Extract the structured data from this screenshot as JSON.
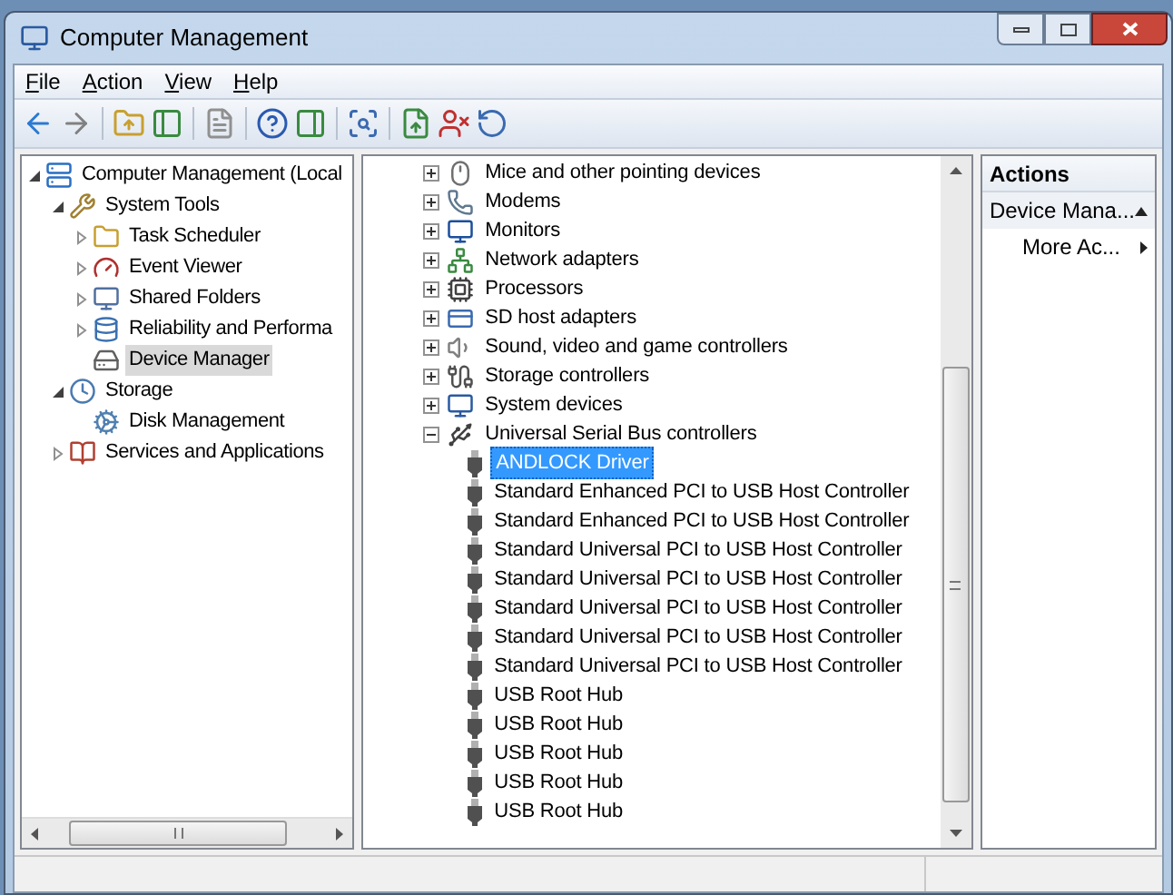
{
  "window": {
    "title": "Computer Management"
  },
  "menu": [
    "File",
    "Action",
    "View",
    "Help"
  ],
  "console_tree": [
    {
      "label": "Computer Management (Local",
      "expanded": true,
      "selected": false,
      "children": [
        {
          "label": "System Tools",
          "expanded": true,
          "selected": false,
          "children": [
            {
              "label": "Task Scheduler",
              "expanded": false,
              "selected": false
            },
            {
              "label": "Event Viewer",
              "expanded": false,
              "selected": false
            },
            {
              "label": "Shared Folders",
              "expanded": false,
              "selected": false
            },
            {
              "label": "Reliability and Performa",
              "expanded": false,
              "selected": false
            },
            {
              "label": "Device Manager",
              "selected": true
            }
          ]
        },
        {
          "label": "Storage",
          "expanded": true,
          "selected": false,
          "children": [
            {
              "label": "Disk Management",
              "selected": false
            }
          ]
        },
        {
          "label": "Services and Applications",
          "expanded": false,
          "selected": false
        }
      ]
    }
  ],
  "device_tree": [
    {
      "label": "Mice and other pointing devices",
      "expanded": false,
      "selected": false
    },
    {
      "label": "Modems",
      "expanded": false,
      "selected": false
    },
    {
      "label": "Monitors",
      "expanded": false,
      "selected": false
    },
    {
      "label": "Network adapters",
      "expanded": false,
      "selected": false
    },
    {
      "label": "Processors",
      "expanded": false,
      "selected": false
    },
    {
      "label": "SD host adapters",
      "expanded": false,
      "selected": false
    },
    {
      "label": "Sound, video and game controllers",
      "expanded": false,
      "selected": false
    },
    {
      "label": "Storage controllers",
      "expanded": false,
      "selected": false
    },
    {
      "label": "System devices",
      "expanded": false,
      "selected": false
    },
    {
      "label": "Universal Serial Bus controllers",
      "expanded": true,
      "selected": false,
      "children": [
        {
          "label": "ANDLOCK Driver",
          "selected": true
        },
        {
          "label": "Standard Enhanced PCI to USB Host Controller",
          "selected": false
        },
        {
          "label": "Standard Enhanced PCI to USB Host Controller",
          "selected": false
        },
        {
          "label": "Standard Universal PCI to USB Host Controller",
          "selected": false
        },
        {
          "label": "Standard Universal PCI to USB Host Controller",
          "selected": false
        },
        {
          "label": "Standard Universal PCI to USB Host Controller",
          "selected": false
        },
        {
          "label": "Standard Universal PCI to USB Host Controller",
          "selected": false
        },
        {
          "label": "Standard Universal PCI to USB Host Controller",
          "selected": false
        },
        {
          "label": "USB Root Hub",
          "selected": false
        },
        {
          "label": "USB Root Hub",
          "selected": false
        },
        {
          "label": "USB Root Hub",
          "selected": false
        },
        {
          "label": "USB Root Hub",
          "selected": false
        },
        {
          "label": "USB Root Hub",
          "selected": false
        }
      ]
    }
  ],
  "actions": {
    "title": "Actions",
    "sections": [
      {
        "label": "Device Mana...",
        "items": [
          {
            "label": "More Ac..."
          }
        ]
      }
    ]
  }
}
